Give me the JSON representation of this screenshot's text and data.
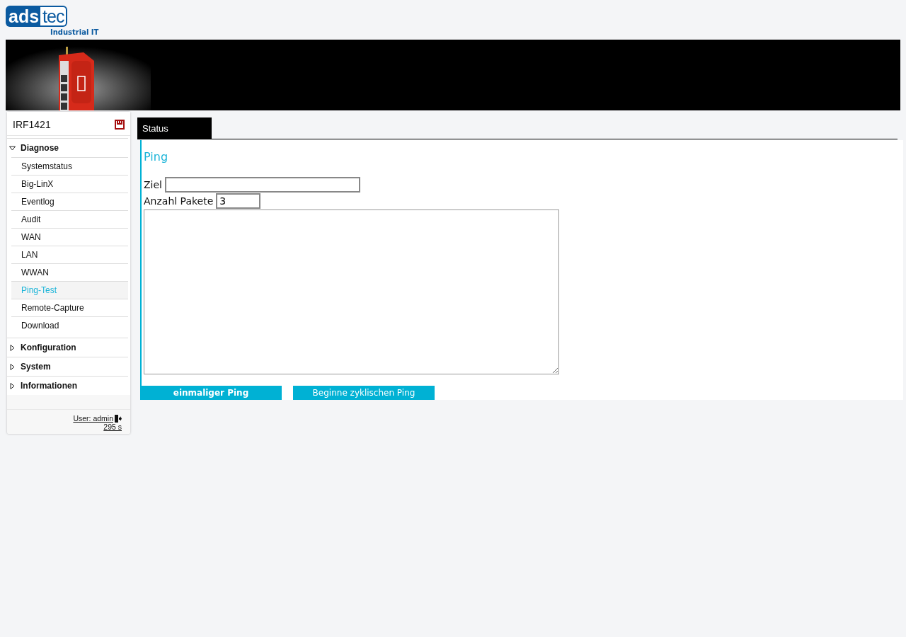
{
  "logo": {
    "part_1": "ads",
    "part_2": "tec",
    "tagline": "Industrial IT"
  },
  "sidebar": {
    "device": "IRF1421",
    "groups": [
      {
        "label": "Diagnose",
        "expanded": true,
        "items": [
          {
            "label": "Systemstatus",
            "selected": false
          },
          {
            "label": "Big-LinX",
            "selected": false
          },
          {
            "label": "Eventlog",
            "selected": false
          },
          {
            "label": "Audit",
            "selected": false
          },
          {
            "label": "WAN",
            "selected": false
          },
          {
            "label": "LAN",
            "selected": false
          },
          {
            "label": "WWAN",
            "selected": false
          },
          {
            "label": "Ping-Test",
            "selected": true
          },
          {
            "label": "Remote-Capture",
            "selected": false
          },
          {
            "label": "Download",
            "selected": false
          }
        ]
      },
      {
        "label": "Konfiguration",
        "expanded": false
      },
      {
        "label": "System",
        "expanded": false
      },
      {
        "label": "Informationen",
        "expanded": false
      }
    ],
    "user": "User: admin",
    "timer": "295 s"
  },
  "tabs": [
    {
      "label": "Status",
      "selected": true
    }
  ],
  "panel": {
    "title": "Ping",
    "fields": [
      {
        "label": "Ziel"
      },
      {
        "label": "Anzahl Pakete",
        "value": "3"
      }
    ],
    "buttons": [
      {
        "label": "einmaliger Ping",
        "kind": "primary"
      },
      {
        "label": "Beginne zyklischen Ping",
        "kind": "secondary"
      }
    ]
  }
}
